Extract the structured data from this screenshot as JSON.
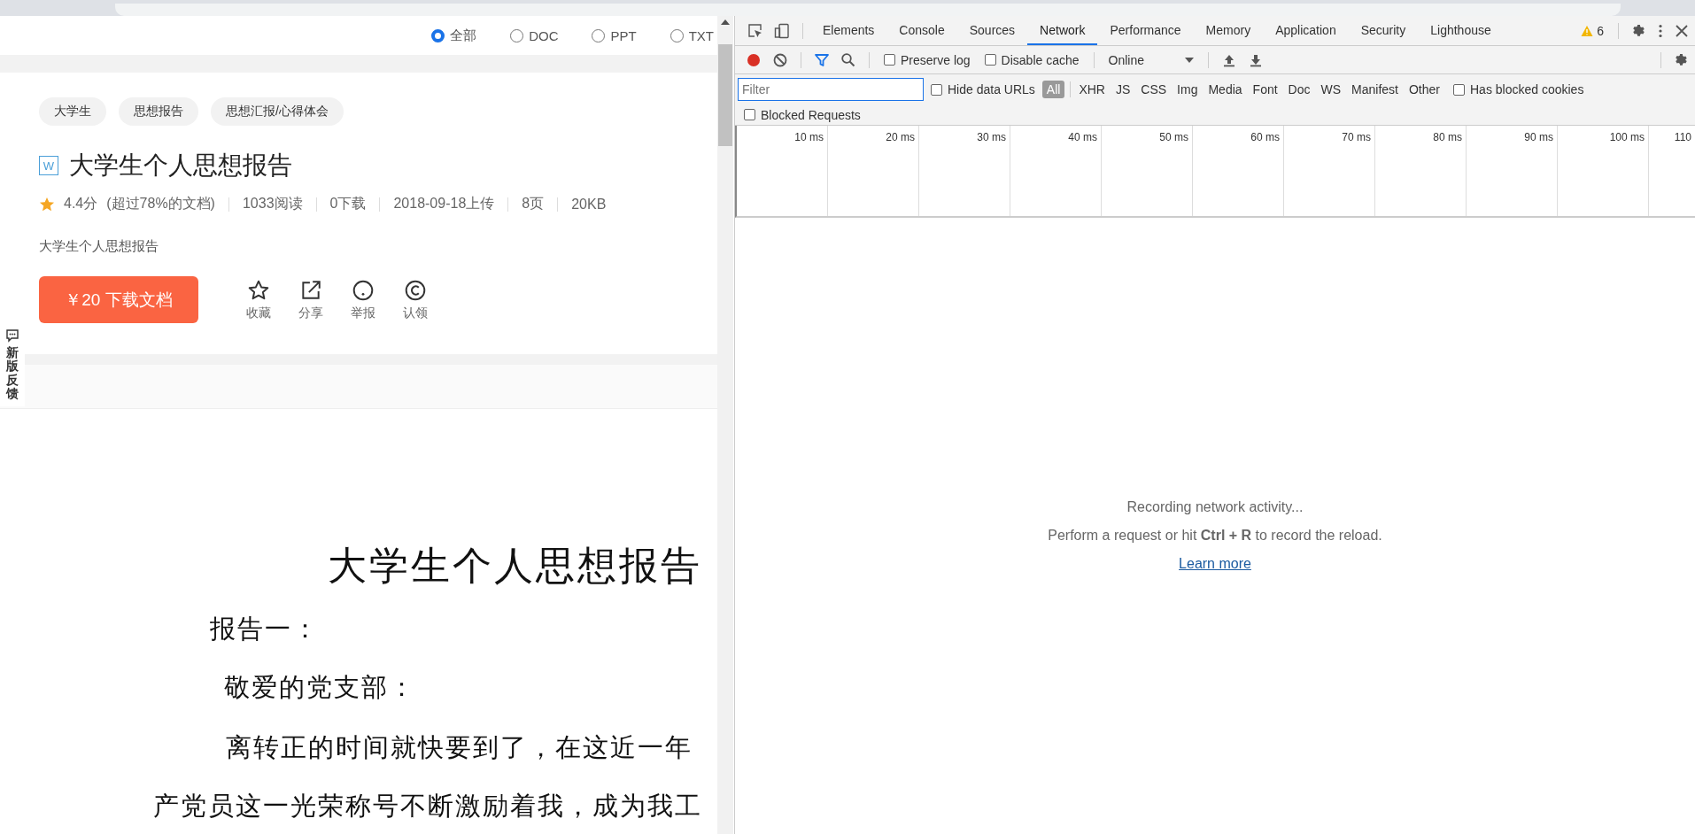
{
  "page": {
    "file_types": [
      {
        "label": "全部",
        "selected": true
      },
      {
        "label": "DOC",
        "selected": false
      },
      {
        "label": "PPT",
        "selected": false
      },
      {
        "label": "TXT",
        "selected": false
      }
    ],
    "tags": [
      "大学生",
      "思想报告",
      "思想汇报/心得体会"
    ],
    "file_badge": "W",
    "doc_title": "大学生个人思想报告",
    "rating": "4.4分",
    "rating_note": "(超过78%的文档)",
    "stats": [
      "1033阅读",
      "0下载",
      "2018-09-18上传",
      "8页",
      "20KB"
    ],
    "description": "大学生个人思想报告",
    "download_button": "￥20 下载文档",
    "actions": [
      {
        "kind": "star",
        "label": "收藏"
      },
      {
        "kind": "share",
        "label": "分享"
      },
      {
        "kind": "report",
        "label": "举报"
      },
      {
        "kind": "claim",
        "label": "认领"
      }
    ],
    "feedback_tab": "新版反馈",
    "document": {
      "heading": "大学生个人思想报告",
      "lines": [
        {
          "kind": "label",
          "text": "报告一："
        },
        {
          "kind": "greeting",
          "text": "敬爱的党支部："
        },
        {
          "kind": "indent",
          "text": "离转正的时间就快要到了，在这近一年"
        },
        {
          "kind": "plain",
          "text": "产党员这一光荣称号不断激励着我，成为我工"
        }
      ]
    }
  },
  "devtools": {
    "tabs": [
      {
        "label": "Elements",
        "selected": false
      },
      {
        "label": "Console",
        "selected": false
      },
      {
        "label": "Sources",
        "selected": false
      },
      {
        "label": "Network",
        "selected": true
      },
      {
        "label": "Performance",
        "selected": false
      },
      {
        "label": "Memory",
        "selected": false
      },
      {
        "label": "Application",
        "selected": false
      },
      {
        "label": "Security",
        "selected": false
      },
      {
        "label": "Lighthouse",
        "selected": false
      }
    ],
    "warnings_count": "6",
    "recording": true,
    "preserve_log": {
      "label": "Preserve log",
      "checked": false
    },
    "disable_cache": {
      "label": "Disable cache",
      "checked": false
    },
    "throttling": "Online",
    "filter": {
      "placeholder": "Filter"
    },
    "hide_data_urls": {
      "label": "Hide data URLs",
      "checked": false
    },
    "type_filters": [
      {
        "label": "All",
        "selected": true
      },
      {
        "label": "XHR",
        "selected": false
      },
      {
        "label": "JS",
        "selected": false
      },
      {
        "label": "CSS",
        "selected": false
      },
      {
        "label": "Img",
        "selected": false
      },
      {
        "label": "Media",
        "selected": false
      },
      {
        "label": "Font",
        "selected": false
      },
      {
        "label": "Doc",
        "selected": false
      },
      {
        "label": "WS",
        "selected": false
      },
      {
        "label": "Manifest",
        "selected": false
      },
      {
        "label": "Other",
        "selected": false
      }
    ],
    "has_blocked_cookies": {
      "label": "Has blocked cookies",
      "checked": false
    },
    "blocked_requests": {
      "label": "Blocked Requests",
      "checked": false
    },
    "timeline_ticks": [
      "10 ms",
      "20 ms",
      "30 ms",
      "40 ms",
      "50 ms",
      "60 ms",
      "70 ms",
      "80 ms",
      "90 ms",
      "100 ms",
      "110"
    ],
    "empty_state": {
      "title": "Recording network activity...",
      "hint": "Perform a request or hit **Ctrl + R** to record the reload.",
      "link": "Learn more"
    }
  }
}
